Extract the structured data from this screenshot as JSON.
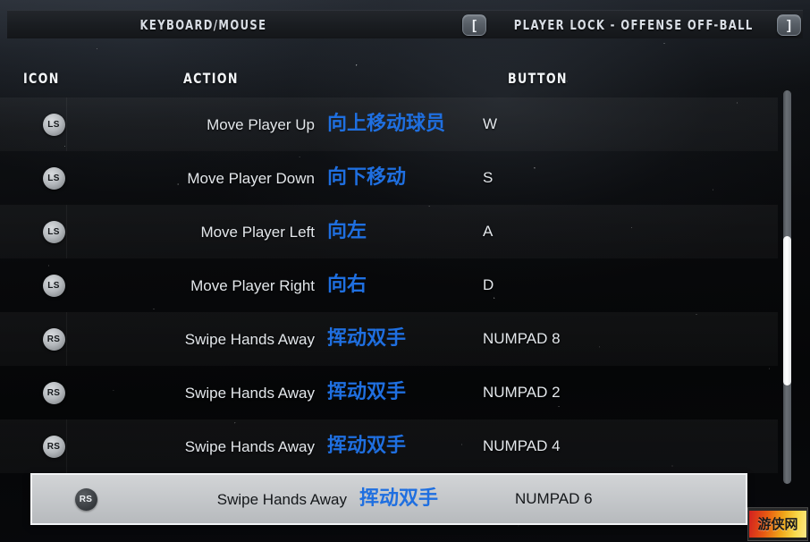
{
  "header": {
    "input_mode": "KEYBOARD/MOUSE",
    "section_title": "PLAYER LOCK - OFFENSE OFF-BALL",
    "prev_bracket": "[",
    "next_bracket": "]"
  },
  "columns": {
    "icon": "ICON",
    "action": "ACTION",
    "button": "BUTTON"
  },
  "colors": {
    "translation_blue": "#1f6fe0",
    "selected_row_bg": "#c6c9cc",
    "text_light": "#e3e7eb"
  },
  "rows": [
    {
      "icon": "LS",
      "action_en": "Move Player Up",
      "action_zh": "向上移动球员",
      "button": "W",
      "selected": false
    },
    {
      "icon": "LS",
      "action_en": "Move Player Down",
      "action_zh": "向下移动",
      "button": "S",
      "selected": false
    },
    {
      "icon": "LS",
      "action_en": "Move Player Left",
      "action_zh": "向左",
      "button": "A",
      "selected": false
    },
    {
      "icon": "LS",
      "action_en": "Move Player Right",
      "action_zh": "向右",
      "button": "D",
      "selected": false
    },
    {
      "icon": "RS",
      "action_en": "Swipe Hands Away",
      "action_zh": "挥动双手",
      "button": "NUMPAD 8",
      "selected": false
    },
    {
      "icon": "RS",
      "action_en": "Swipe Hands Away",
      "action_zh": "挥动双手",
      "button": "NUMPAD 2",
      "selected": false
    },
    {
      "icon": "RS",
      "action_en": "Swipe Hands Away",
      "action_zh": "挥动双手",
      "button": "NUMPAD 4",
      "selected": false
    },
    {
      "icon": "RS",
      "action_en": "Swipe Hands Away",
      "action_zh": "挥动双手",
      "button": "NUMPAD 6",
      "selected": true
    }
  ],
  "scrollbar": {
    "thumb_top_pct": 37,
    "thumb_height_pct": 38
  },
  "watermark": {
    "text": "游侠网"
  }
}
